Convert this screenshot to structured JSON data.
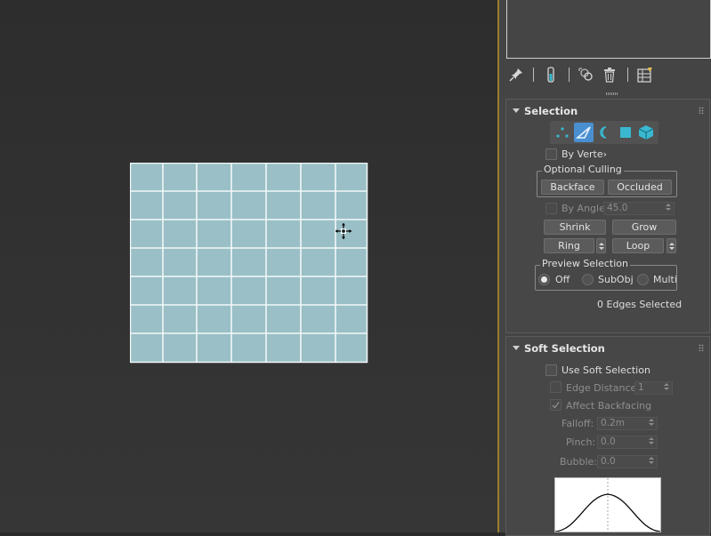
{
  "viewport": {
    "grid_cols": 7,
    "grid_rows": 7
  },
  "toolbar": {
    "icons": [
      "pin-stack-icon",
      "show-end-result-icon",
      "make-unique-icon",
      "remove-modifier-icon",
      "configure-modifier-sets-icon"
    ]
  },
  "selection": {
    "title": "Selection",
    "modes": [
      "vertex-mode-icon",
      "edge-mode-icon",
      "border-mode-icon",
      "polygon-mode-icon",
      "element-mode-icon"
    ],
    "active_mode": "edge-mode-icon",
    "by_vertex_label": "By Verte›",
    "optional_culling": {
      "title": "Optional Culling",
      "backface_label": "Backface",
      "occluded_label": "Occluded"
    },
    "by_angle_label": "By Angle:",
    "by_angle_value": "45.0",
    "shrink_label": "Shrink",
    "grow_label": "Grow",
    "ring_label": "Ring",
    "loop_label": "Loop",
    "preview": {
      "title": "Preview Selection",
      "off_label": "Off",
      "subobj_label": "SubObj",
      "multi_label": "Multi",
      "selected": "Off"
    },
    "status": "0 Edges Selected"
  },
  "soft_selection": {
    "title": "Soft Selection",
    "use_label": "Use Soft Selection",
    "edge_distance_label": "Edge Distance:",
    "edge_distance_value": "1",
    "affect_backfacing_label": "Affect Backfacing",
    "falloff_label": "Falloff:",
    "falloff_value": "0.2m",
    "pinch_label": "Pinch:",
    "pinch_value": "0.0",
    "bubble_label": "Bubble:",
    "bubble_value": "0.0"
  },
  "colors": {
    "plane_fill": "#9abfc6",
    "plane_lines": "#f2f8f8",
    "active_mode_bg": "#4a8fd0",
    "mode_icon_cyan": "#39b8d0",
    "panel_bg": "#444444",
    "divider": "#9a7c2a"
  }
}
